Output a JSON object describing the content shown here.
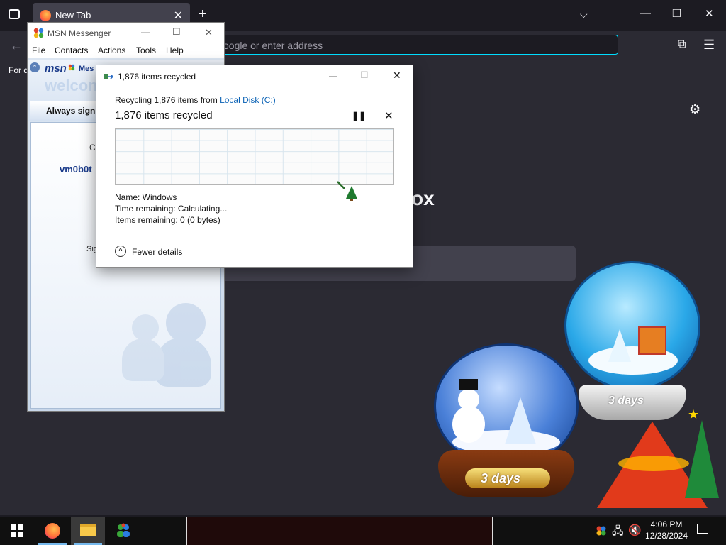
{
  "firefox": {
    "tab_title": "New Tab",
    "tab_close": "✕",
    "newtab_glyph": "+",
    "url_placeholder": "oogle or enter address",
    "bookmarks_fragment": "For q",
    "content_brand_fragment": "ox",
    "window_controls": {
      "minimize": "—",
      "maximize": "❐",
      "close": "✕"
    }
  },
  "msn": {
    "title": "MSN Messenger",
    "menu": [
      "File",
      "Contacts",
      "Actions",
      "Tools",
      "Help"
    ],
    "logo_text": "msn",
    "logo_fragment": "Mes",
    "welcome_fragment": "welcon",
    "always_sign_fragment": "Always sign",
    "panel_fragment_1": "Cl",
    "account_fragment": "vm0b0t",
    "panel_fragment_2": "Sig",
    "window_controls": {
      "minimize": "—",
      "maximize": "☐",
      "close": "✕"
    }
  },
  "dialog": {
    "title": "1,876 items recycled",
    "recycling_prefix": "Recycling 1,876 items from ",
    "source_link": "Local Disk (C:)",
    "heading": "1,876 items recycled",
    "pause_glyph": "❚❚",
    "stop_glyph": "✕",
    "name_line": "Name:  Windows",
    "time_line": "Time remaining:  Calculating...",
    "items_line": "Items remaining:  0 (0 bytes)",
    "fewer_details": "Fewer details",
    "fewer_glyph": "^",
    "window_controls": {
      "minimize": "—",
      "maximize": "☐",
      "close": "✕"
    }
  },
  "desktop": {
    "globe_left_label": "3 days",
    "globe_right_label": "3 days"
  },
  "taskbar": {
    "time": "4:06 PM",
    "date": "12/28/2024"
  },
  "colors": {
    "accent": "#00ddff",
    "link": "#0a62b5",
    "msn_blue": "#1a3a8a"
  }
}
